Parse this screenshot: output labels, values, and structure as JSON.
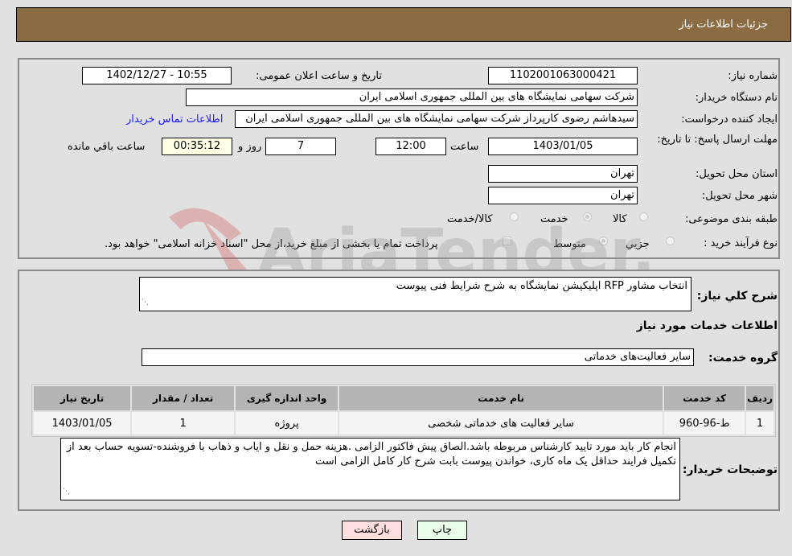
{
  "header": {
    "title": "جزئیات اطلاعات نیاز"
  },
  "need_info": {
    "need_number_label": "شماره نیاز:",
    "need_number": "1102001063000421",
    "announce_label": "تاریخ و ساعت اعلان عمومی:",
    "announce_value": "1402/12/27 - 10:55",
    "buyer_org_label": "نام دستگاه خریدار:",
    "buyer_org": "شرکت سهامی نمایشگاه های بین المللی جمهوری اسلامی ایران",
    "creator_label": "ایجاد کننده درخواست:",
    "creator": "سیدهاشم رضوی کارپرداز شرکت سهامی نمایشگاه های بین المللی جمهوری اسلامی ایران",
    "contact_link": "اطلاعات تماس خریدار",
    "deadline_label": "مهلت ارسال پاسخ: تا تاریخ:",
    "deadline_date": "1403/01/05",
    "time_label": "ساعت",
    "deadline_time": "12:00",
    "days_value": "7",
    "days_label": "روز و",
    "remaining_time": "00:35:12",
    "remaining_label": "ساعت باقي مانده",
    "province_label": "استان محل تحویل:",
    "province": "تهران",
    "city_label": "شهر محل تحویل:",
    "city": "تهران",
    "category_label": "طبقه بندی موضوعی:",
    "category_options": [
      "کالا",
      "خدمت",
      "کالا/خدمت"
    ],
    "category_selected": "خدمت",
    "process_label": "نوع فرآیند خرید :",
    "process_options": [
      "جزیي",
      "متوسط"
    ],
    "process_selected": "متوسط",
    "treasury_note": "پرداخت تمام یا بخشی از مبلغ خرید،از محل \"اسناد خزانه اسلامی\" خواهد بود."
  },
  "summary": {
    "description_label": "شرح کلي نیاز:",
    "description": "انتخاب مشاور RFP اپلیکیشن نمایشگاه به شرح شرایط فنی پیوست",
    "services_title": "اطلاعات خدمات مورد نیاز",
    "service_group_label": "گروه خدمت:",
    "service_group": "سایر فعالیت‌های خدماتی"
  },
  "table": {
    "headers": [
      "ردیف",
      "کد خدمت",
      "نام خدمت",
      "واحد اندازه گیری",
      "تعداد / مقدار",
      "تاریخ نیاز"
    ],
    "rows": [
      [
        "1",
        "ط-96-960",
        "سایر فعالیت های خدماتی شخصی",
        "پروژه",
        "1",
        "1403/01/05"
      ]
    ]
  },
  "buyer_notes": {
    "label": "توضیحات خریدار:",
    "text": "انجام کار باید  مورد تایید کارشناس  مربوطه باشد.الصاق پیش فاکتور الزامی .هزینه حمل و نقل و ایاب و ذهاب با فروشنده-تسویه حساب بعد از تکمیل فرایند حداقل یک ماه کاری، خواندن پیوست بابت شرح کار کامل الزامی است"
  },
  "buttons": {
    "print": "چاپ",
    "back": "بازگشت"
  },
  "watermark": {
    "text": "AriaTender.neT"
  }
}
